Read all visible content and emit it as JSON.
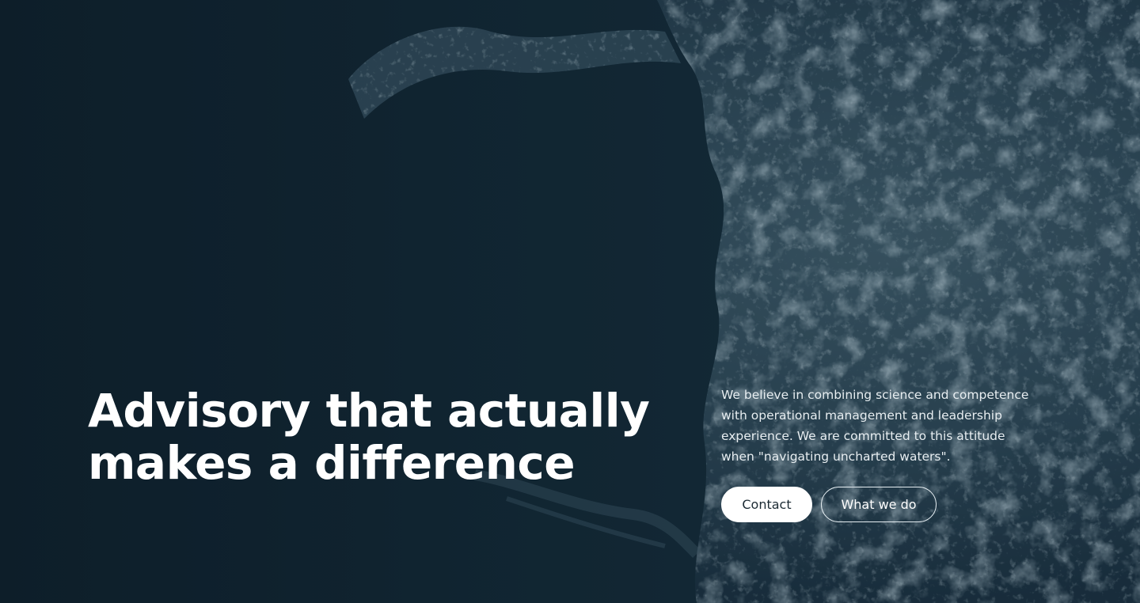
{
  "hero": {
    "headline_line1": "Advisory that actually",
    "headline_line2": "makes a difference",
    "intro_line1": "We believe in combining science and competence",
    "intro_line2": "with operational management and leadership",
    "intro_line3": "experience. We are committed to this attitude",
    "intro_line4": "when \"navigating uncharted waters\".",
    "contact_label": "Contact",
    "what_we_do_label": "What we do",
    "background_image": "aerial-ocean-waves-photo"
  },
  "colors": {
    "deep_water": "#0f2230",
    "foam": "#4a6676",
    "text": "#ffffff"
  }
}
